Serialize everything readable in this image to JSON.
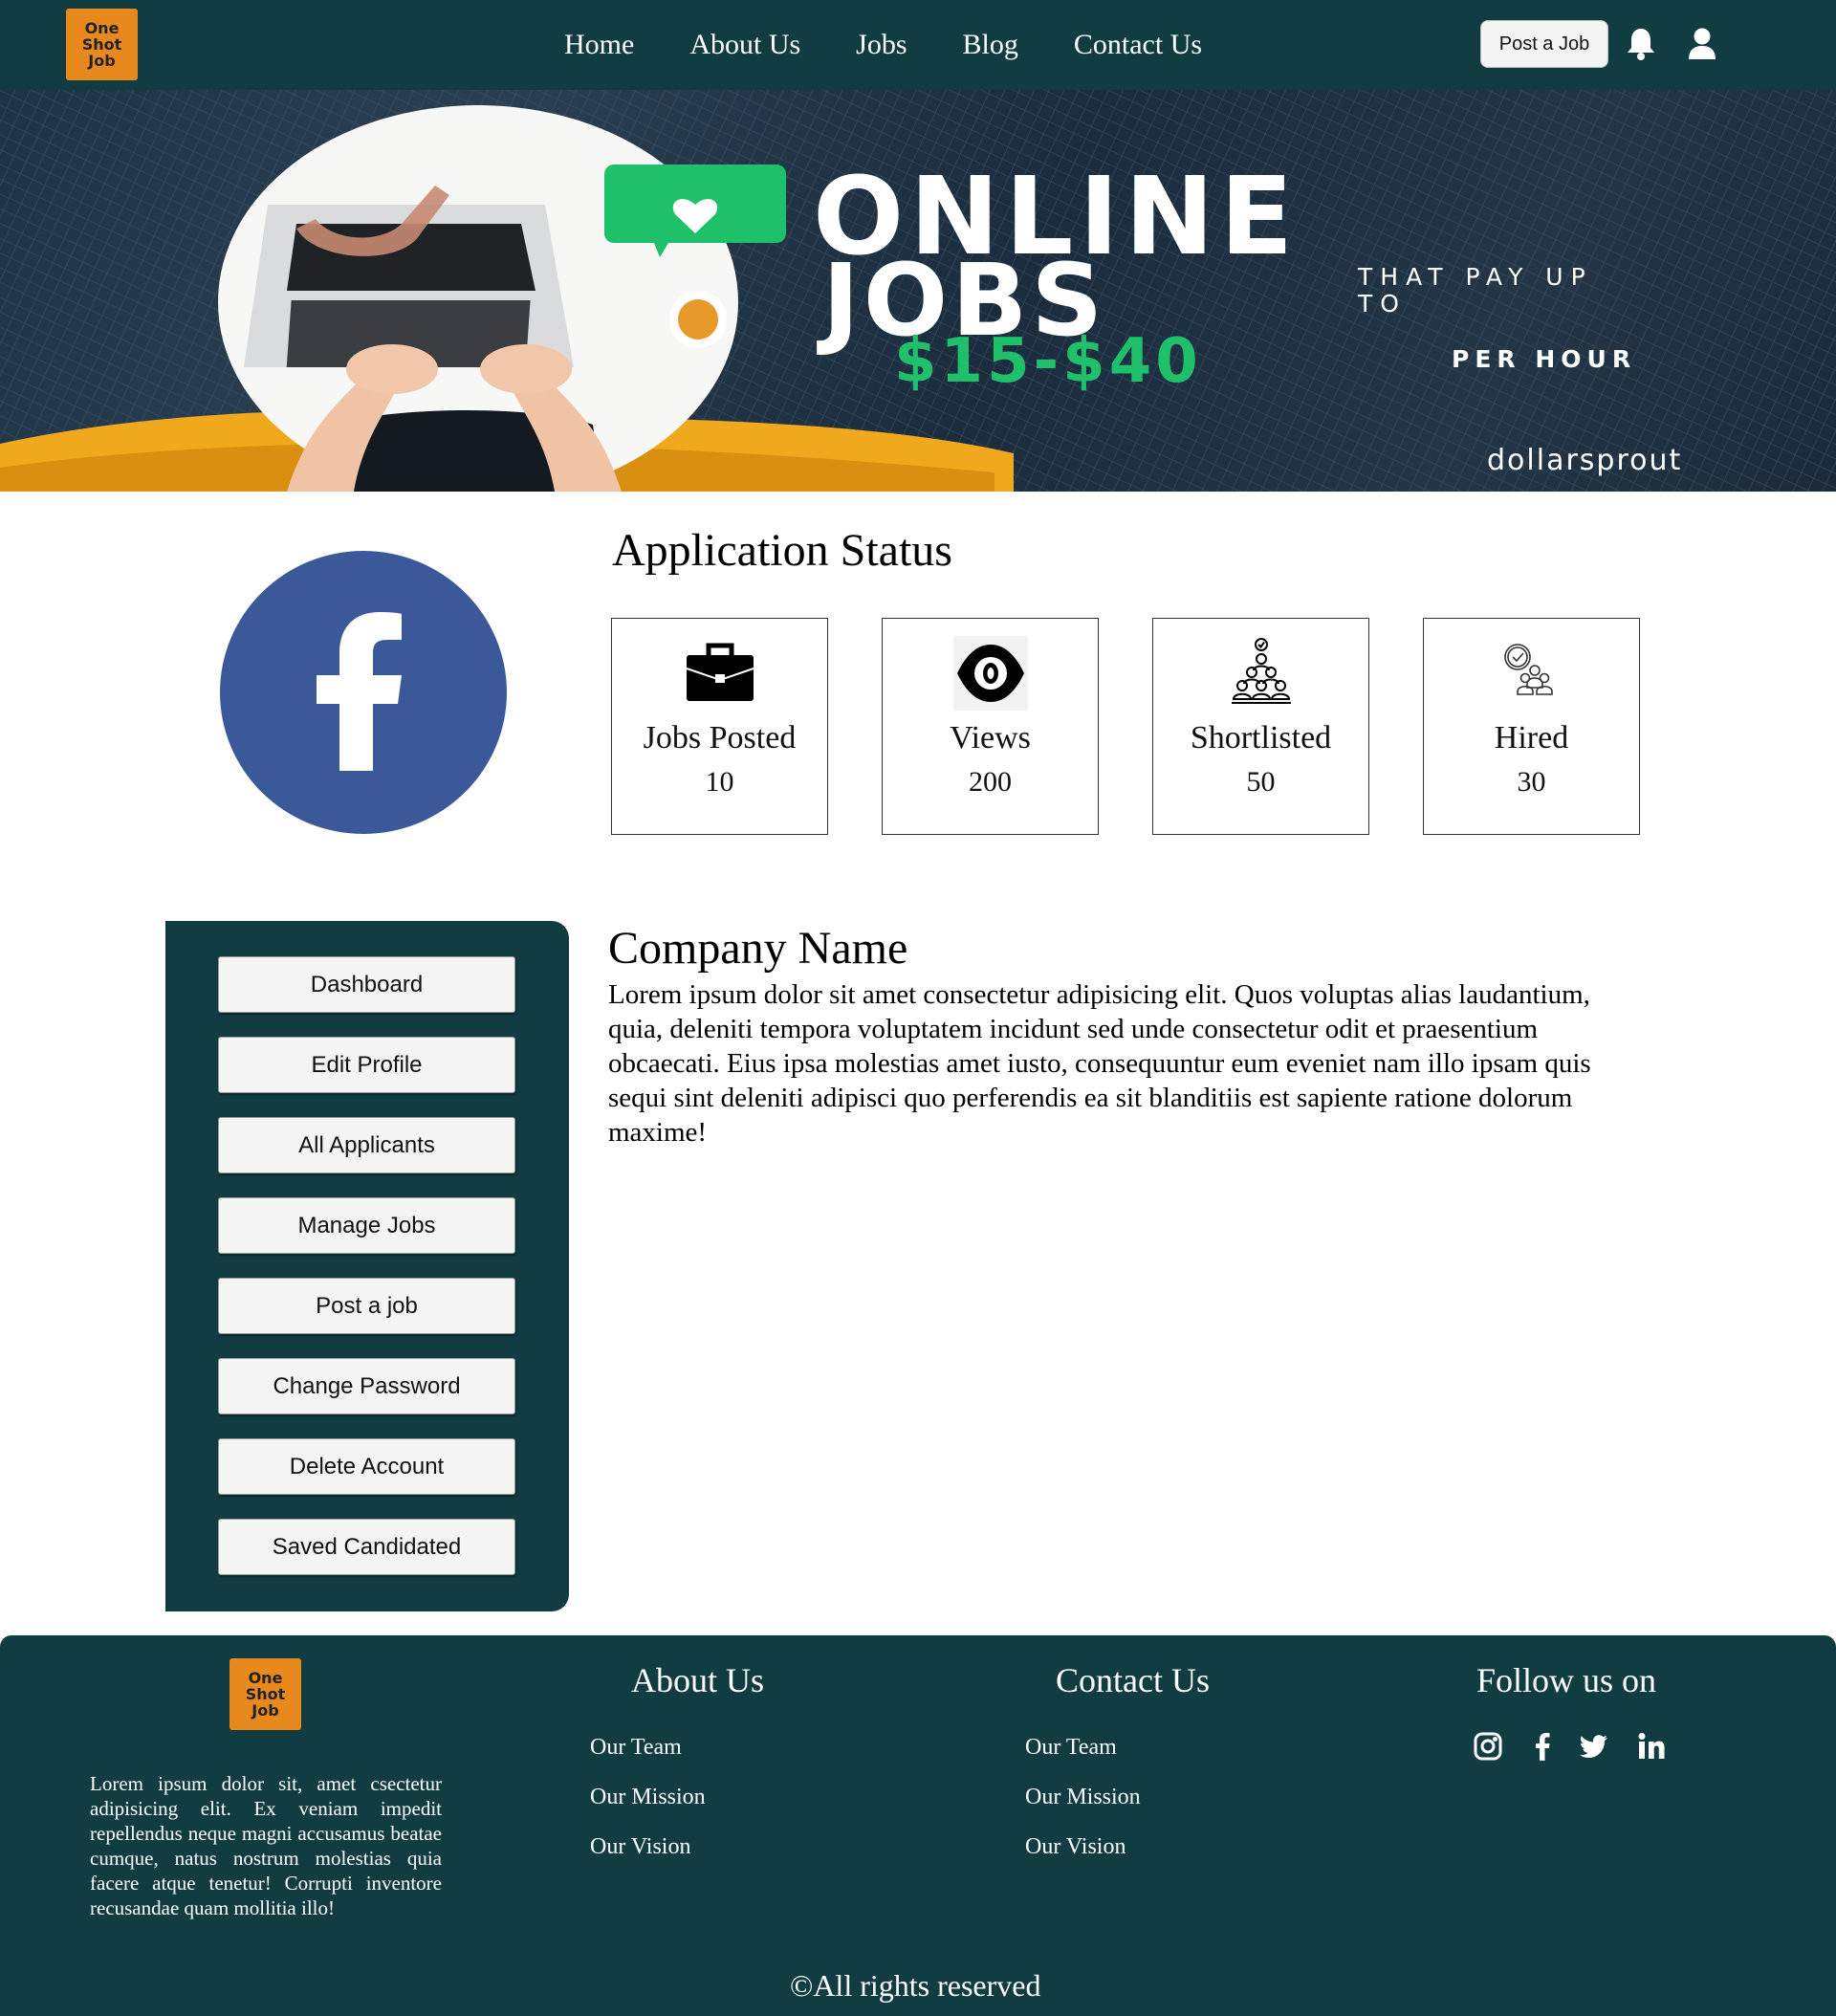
{
  "header": {
    "logo_lines": [
      "One",
      "Shot",
      "Job"
    ],
    "nav": [
      "Home",
      "About Us",
      "Jobs",
      "Blog",
      "Contact Us"
    ],
    "post_job_label": "Post a Job"
  },
  "banner": {
    "line1": "ONLINE",
    "line2": "JOBS",
    "that_pay": "THAT PAY UP TO",
    "amount": "$15-$40",
    "per_hour": "PER HOUR",
    "brand": "dollarsprout"
  },
  "status": {
    "title": "Application Status",
    "cards": [
      {
        "icon": "briefcase-icon",
        "label": "Jobs Posted",
        "value": "10"
      },
      {
        "icon": "eye-icon",
        "label": "Views",
        "value": "200"
      },
      {
        "icon": "shortlist-group-icon",
        "label": "Shortlisted",
        "value": "50"
      },
      {
        "icon": "hired-people-icon",
        "label": "Hired",
        "value": "30"
      }
    ]
  },
  "sidebar": {
    "items": [
      "Dashboard",
      "Edit Profile",
      "All Applicants",
      "Manage Jobs",
      "Post a job",
      "Change Password",
      "Delete Account",
      "Saved Candidated"
    ]
  },
  "company": {
    "name": "Company Name",
    "description": "Lorem ipsum dolor sit amet consectetur adipisicing elit. Quos voluptas alias laudantium, quia, deleniti tempora voluptatem incidunt sed unde consectetur odit et praesentium obcaecati. Eius ipsa molestias amet iusto, consequuntur eum eveniet nam illo ipsam quis sequi sint deleniti adipisci quo perferendis ea sit blanditiis est sapiente ratione dolorum maxime!"
  },
  "footer": {
    "description": "Lorem ipsum dolor sit, amet csectetur adipisicing elit. Ex veniam impedit repellendus neque magni accusamus beatae cumque, natus nostrum molestias quia facere atque tenetur! Corrupti inventore recusandae quam mollitia illo!",
    "about_heading": "About Us",
    "about_links": [
      "Our Team",
      "Our Mission",
      "Our Vision"
    ],
    "contact_heading": "Contact Us",
    "contact_links": [
      "Our Team",
      "Our Mission",
      "Our Vision"
    ],
    "follow_heading": "Follow us on",
    "social": [
      "instagram-icon",
      "facebook-icon",
      "twitter-icon",
      "linkedin-icon"
    ],
    "copyright": "©All rights reserved"
  },
  "colors": {
    "primary": "#113c42",
    "logo": "#e8891e",
    "facebook": "#3b5998",
    "banner_green": "#1fc06a"
  }
}
